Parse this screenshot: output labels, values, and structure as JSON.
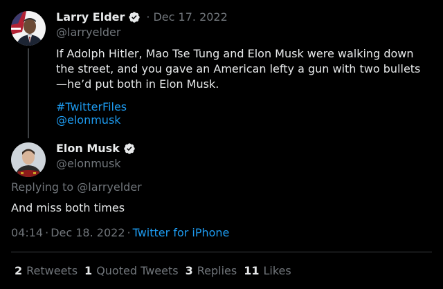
{
  "original_tweet": {
    "author_name": "Larry Elder",
    "handle": "@larryelder",
    "date": "Dec 17. 2022",
    "text": "If Adolph Hitler, Mao Tse Tung and Elon Musk were walking down the street, and you gave an American lefty a gun with two bullets —he’d put both in Elon Musk.",
    "hashtag": "#TwitterFiles",
    "mention": "@elonmusk"
  },
  "reply_tweet": {
    "author_name": "Elon Musk",
    "handle": "@elonmusk",
    "replying_to_prefix": "Replying to",
    "replying_to_handle": "@larryelder",
    "text": "And miss both times",
    "time": "04:14",
    "date": "Dec 18. 2022",
    "source": "Twitter for iPhone"
  },
  "stats": {
    "retweets_count": "2",
    "retweets_label": "Retweets",
    "quoted_count": "1",
    "quoted_label": "Quoted Tweets",
    "replies_count": "3",
    "replies_label": "Replies",
    "likes_count": "11",
    "likes_label": "Likes"
  },
  "colors": {
    "background": "#000000",
    "text": "#e7e9ea",
    "muted": "#71767b",
    "link": "#1d9bf0",
    "verified": "#e7e9ea"
  },
  "icons": [
    "verified-badge-icon",
    "avatar-larry-elder",
    "avatar-elon-musk"
  ]
}
